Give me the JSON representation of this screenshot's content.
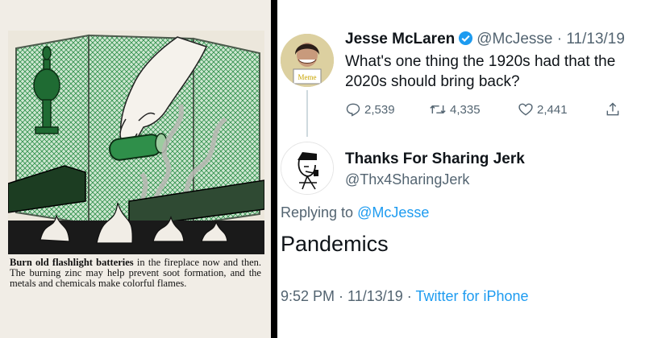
{
  "left_panel": {
    "caption_lead": "Burn old flashlight batteries",
    "caption_rest": " in the fireplace now and then. The burning zinc may help prevent soot formation, and the metals and chemicals make colorful flames."
  },
  "tweet": {
    "author_name": "Jesse McLaren",
    "verified": true,
    "handle": "@McJesse",
    "date": "11/13/19",
    "text": "What's one thing the 1920s had that the 2020s should bring back?",
    "avatar_sign": "Meme",
    "stats": {
      "replies": "2,539",
      "retweets": "4,335",
      "likes": "2,441"
    }
  },
  "reply": {
    "author_name": "Thanks For Sharing Jerk",
    "handle": "@Thx4SharingJerk",
    "replying_prefix": "Replying to",
    "replying_to": "@McJesse",
    "text": "Pandemics",
    "time": "9:52 PM",
    "date": "11/13/19",
    "source": "Twitter for iPhone"
  },
  "colors": {
    "link": "#1d9bf0",
    "secondary": "#536471",
    "primary_text": "#0f1419",
    "screen_green": "#2f8f4a"
  },
  "icons": [
    "reply-icon",
    "retweet-icon",
    "like-icon",
    "share-icon",
    "verified-icon"
  ]
}
